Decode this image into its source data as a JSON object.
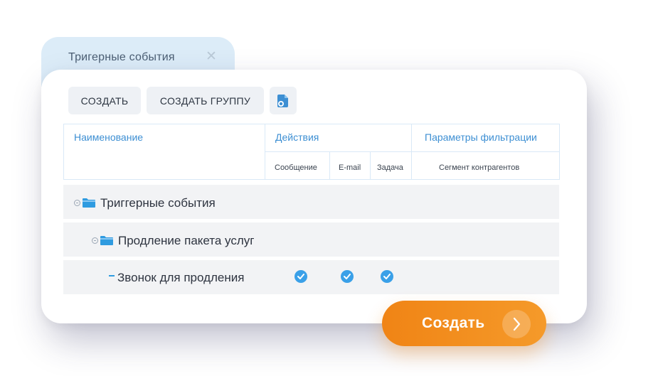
{
  "tab": {
    "title": "Тригерные события",
    "close_glyph": "✕"
  },
  "toolbar": {
    "create_label": "СОЗДАТЬ",
    "create_group_label": "СОЗДАТЬ ГРУППУ",
    "doc_icon": "document-settings-icon"
  },
  "table": {
    "headers": {
      "name": "Наименование",
      "actions": "Действия",
      "filter": "Параметры фильтрации"
    },
    "subheaders": {
      "message": "Сообщение",
      "email": "E-mail",
      "task": "Задача",
      "segment": "Сегмент контрагентов"
    },
    "rows": [
      {
        "label": "Триггерные события",
        "type": "folder",
        "expanded": true
      },
      {
        "label": "Продление пакета услуг",
        "type": "folder",
        "expanded": true
      },
      {
        "label": "Звонок для продления",
        "type": "item",
        "message": true,
        "email": true,
        "task": true
      }
    ]
  },
  "cta": {
    "label": "Создать",
    "arrow": "›"
  },
  "colors": {
    "accent": "#3d8fd3",
    "cta": "#f08415",
    "check": "#3aa0e8"
  }
}
